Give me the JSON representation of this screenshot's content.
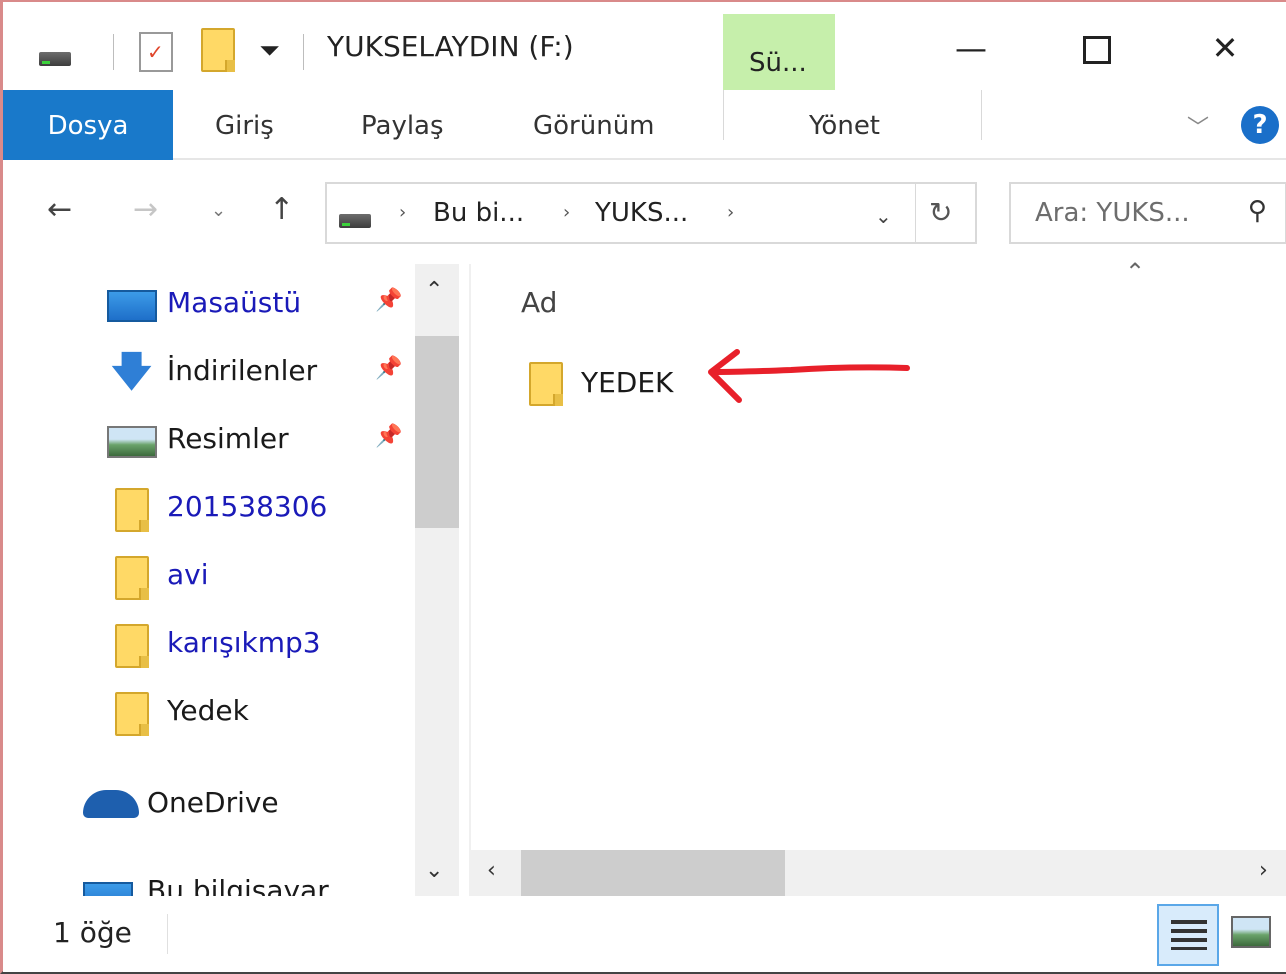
{
  "window": {
    "title": "YUKSELAYDIN (F:)",
    "tools_tab": "Sü..."
  },
  "ribbon": {
    "tabs": [
      "Dosya",
      "Giriş",
      "Paylaş",
      "Görünüm",
      "Yönet"
    ]
  },
  "address": {
    "crumbs": [
      "Bu bi...",
      "YUKS..."
    ],
    "search_placeholder": "Ara: YUKS..."
  },
  "nav_pane": {
    "items": [
      {
        "label": "Masaüstü",
        "icon": "desktop-icon",
        "pinned": true
      },
      {
        "label": "İndirilenler",
        "icon": "download-icon",
        "pinned": true
      },
      {
        "label": "Resimler",
        "icon": "pictures-icon",
        "pinned": true
      },
      {
        "label": "201538306",
        "icon": "folder-icon"
      },
      {
        "label": "avi",
        "icon": "folder-icon"
      },
      {
        "label": "karışıkmp3",
        "icon": "folder-icon"
      },
      {
        "label": "Yedek",
        "icon": "folder-icon"
      },
      {
        "label": "OneDrive",
        "icon": "onedrive-icon"
      },
      {
        "label": "Bu bilgisayar",
        "icon": "this-pc-icon"
      }
    ]
  },
  "content": {
    "column_header": "Ad",
    "files": [
      {
        "name": "YEDEK",
        "icon": "folder-icon"
      }
    ]
  },
  "status": {
    "item_count": "1 öğe"
  },
  "colors": {
    "file_tab": "#1979ca",
    "tools_tab": "#c6efab",
    "annotation_arrow": "#e8202a",
    "nav_link": "#1a1ab8"
  }
}
